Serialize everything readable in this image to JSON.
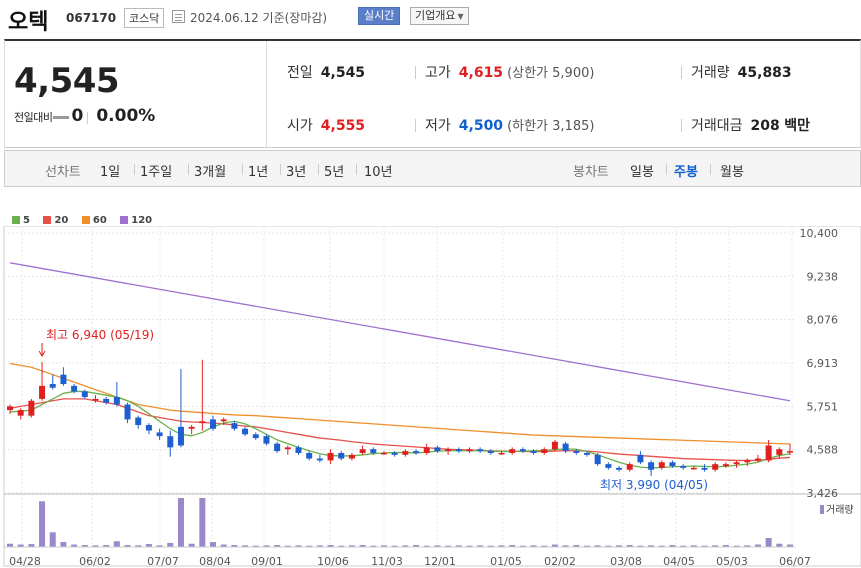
{
  "header": {
    "name": "오텍",
    "code": "067170",
    "market": "코스닥",
    "date": "2024.06.12",
    "basis": "기준(장마감)",
    "realtime_button": "실시간",
    "company_button": "기업개요"
  },
  "summary": {
    "current_price": "4,545",
    "change_label": "전일대비",
    "change_value": "0",
    "change_pct": "0.00%",
    "prev_close_label": "전일",
    "prev_close": "4,545",
    "high_label": "고가",
    "high": "4,615",
    "upper_limit": "(상한가 5,900)",
    "volume_label": "거래량",
    "volume": "45,883",
    "open_label": "시가",
    "open": "4,555",
    "low_label": "저가",
    "low": "4,500",
    "lower_limit": "(하한가 3,185)",
    "amount_label": "거래대금",
    "amount": "208",
    "amount_unit": "백만"
  },
  "period_bar": {
    "line_label": "선차트",
    "line_options": [
      "1일",
      "1주일",
      "3개월",
      "1년",
      "3년",
      "5년",
      "10년"
    ],
    "candle_label": "봉차트",
    "candle_options": [
      "일봉",
      "주봉",
      "월봉"
    ],
    "selected": "주봉"
  },
  "legend": [
    {
      "label": "5",
      "color": "#6ab04c"
    },
    {
      "label": "20",
      "color": "#e8504a"
    },
    {
      "label": "60",
      "color": "#f0902c"
    },
    {
      "label": "120",
      "color": "#a070d0"
    }
  ],
  "chart_data": {
    "type": "candlestick",
    "interval": "weekly",
    "y_ticks": [
      "10,400",
      "9,238",
      "8,076",
      "6,913",
      "5,751",
      "4,588",
      "3,426"
    ],
    "ylim": [
      3426,
      10400
    ],
    "x_ticks": [
      "04/28",
      "06/02",
      "07/07",
      "08/04",
      "09/01",
      "10/06",
      "11/03",
      "12/01",
      "01/05",
      "02/02",
      "03/08",
      "04/05",
      "05/03",
      "06/07"
    ],
    "volume_label": "거래량",
    "annotations": [
      {
        "text": "최고 6,940 (05/19)",
        "value": 6940
      },
      {
        "text": "최저 3,990 (04/05)",
        "value": 3990
      }
    ],
    "candles": [
      {
        "o": 5650,
        "h": 5800,
        "l": 5550,
        "c": 5750
      },
      {
        "o": 5500,
        "h": 5700,
        "l": 5400,
        "c": 5650
      },
      {
        "o": 5500,
        "h": 5950,
        "l": 5450,
        "c": 5900
      },
      {
        "o": 5950,
        "h": 6940,
        "l": 5900,
        "c": 6300
      },
      {
        "o": 6350,
        "h": 6600,
        "l": 6200,
        "c": 6250
      },
      {
        "o": 6600,
        "h": 6800,
        "l": 6300,
        "c": 6350
      },
      {
        "o": 6300,
        "h": 6350,
        "l": 6100,
        "c": 6150
      },
      {
        "o": 6150,
        "h": 6200,
        "l": 5950,
        "c": 6000
      },
      {
        "o": 5950,
        "h": 6050,
        "l": 5850,
        "c": 5950
      },
      {
        "o": 5950,
        "h": 6000,
        "l": 5800,
        "c": 5850
      },
      {
        "o": 6000,
        "h": 6400,
        "l": 5750,
        "c": 5800
      },
      {
        "o": 5800,
        "h": 5850,
        "l": 5300,
        "c": 5400
      },
      {
        "o": 5450,
        "h": 5500,
        "l": 5150,
        "c": 5250
      },
      {
        "o": 5250,
        "h": 5300,
        "l": 5000,
        "c": 5100
      },
      {
        "o": 5050,
        "h": 5150,
        "l": 4850,
        "c": 4950
      },
      {
        "o": 4950,
        "h": 5100,
        "l": 4400,
        "c": 4650
      },
      {
        "o": 5200,
        "h": 6750,
        "l": 4650,
        "c": 4700
      },
      {
        "o": 5150,
        "h": 5250,
        "l": 5000,
        "c": 5200
      },
      {
        "o": 5300,
        "h": 7000,
        "l": 5100,
        "c": 5350
      },
      {
        "o": 5400,
        "h": 5500,
        "l": 5100,
        "c": 5150
      },
      {
        "o": 5350,
        "h": 5450,
        "l": 5250,
        "c": 5400
      },
      {
        "o": 5300,
        "h": 5350,
        "l": 5100,
        "c": 5150
      },
      {
        "o": 5150,
        "h": 5200,
        "l": 4950,
        "c": 5000
      },
      {
        "o": 5000,
        "h": 5050,
        "l": 4850,
        "c": 4900
      },
      {
        "o": 4950,
        "h": 5000,
        "l": 4700,
        "c": 4750
      },
      {
        "o": 4750,
        "h": 4800,
        "l": 4500,
        "c": 4550
      },
      {
        "o": 4600,
        "h": 4700,
        "l": 4450,
        "c": 4650
      },
      {
        "o": 4650,
        "h": 4700,
        "l": 4450,
        "c": 4500
      },
      {
        "o": 4500,
        "h": 4550,
        "l": 4300,
        "c": 4350
      },
      {
        "o": 4350,
        "h": 4450,
        "l": 4250,
        "c": 4300
      },
      {
        "o": 4300,
        "h": 4600,
        "l": 4200,
        "c": 4500
      },
      {
        "o": 4500,
        "h": 4550,
        "l": 4300,
        "c": 4350
      },
      {
        "o": 4350,
        "h": 4500,
        "l": 4300,
        "c": 4450
      },
      {
        "o": 4500,
        "h": 4700,
        "l": 4450,
        "c": 4600
      },
      {
        "o": 4600,
        "h": 4650,
        "l": 4450,
        "c": 4500
      },
      {
        "o": 4500,
        "h": 4550,
        "l": 4450,
        "c": 4500
      },
      {
        "o": 4500,
        "h": 4550,
        "l": 4400,
        "c": 4450
      },
      {
        "o": 4450,
        "h": 4600,
        "l": 4400,
        "c": 4550
      },
      {
        "o": 4550,
        "h": 4600,
        "l": 4450,
        "c": 4500
      },
      {
        "o": 4500,
        "h": 4750,
        "l": 4450,
        "c": 4650
      },
      {
        "o": 4650,
        "h": 4700,
        "l": 4500,
        "c": 4550
      },
      {
        "o": 4550,
        "h": 4650,
        "l": 4450,
        "c": 4600
      },
      {
        "o": 4600,
        "h": 4650,
        "l": 4500,
        "c": 4550
      },
      {
        "o": 4550,
        "h": 4650,
        "l": 4500,
        "c": 4600
      },
      {
        "o": 4600,
        "h": 4650,
        "l": 4500,
        "c": 4550
      },
      {
        "o": 4550,
        "h": 4600,
        "l": 4450,
        "c": 4500
      },
      {
        "o": 4500,
        "h": 4550,
        "l": 4450,
        "c": 4500
      },
      {
        "o": 4500,
        "h": 4650,
        "l": 4450,
        "c": 4600
      },
      {
        "o": 4600,
        "h": 4650,
        "l": 4500,
        "c": 4550
      },
      {
        "o": 4550,
        "h": 4600,
        "l": 4450,
        "c": 4500
      },
      {
        "o": 4500,
        "h": 4650,
        "l": 4450,
        "c": 4600
      },
      {
        "o": 4600,
        "h": 4850,
        "l": 4550,
        "c": 4800
      },
      {
        "o": 4750,
        "h": 4800,
        "l": 4500,
        "c": 4550
      },
      {
        "o": 4550,
        "h": 4600,
        "l": 4450,
        "c": 4500
      },
      {
        "o": 4500,
        "h": 4550,
        "l": 4400,
        "c": 4450
      },
      {
        "o": 4450,
        "h": 4500,
        "l": 4150,
        "c": 4200
      },
      {
        "o": 4200,
        "h": 4250,
        "l": 4050,
        "c": 4100
      },
      {
        "o": 4100,
        "h": 4150,
        "l": 4000,
        "c": 4050
      },
      {
        "o": 4050,
        "h": 4250,
        "l": 4000,
        "c": 4200
      },
      {
        "o": 4450,
        "h": 4550,
        "l": 4200,
        "c": 4250
      },
      {
        "o": 4250,
        "h": 4300,
        "l": 3990,
        "c": 4050
      },
      {
        "o": 4100,
        "h": 4300,
        "l": 4050,
        "c": 4250
      },
      {
        "o": 4250,
        "h": 4300,
        "l": 4100,
        "c": 4150
      },
      {
        "o": 4150,
        "h": 4200,
        "l": 4050,
        "c": 4100
      },
      {
        "o": 4100,
        "h": 4150,
        "l": 4050,
        "c": 4100
      },
      {
        "o": 4100,
        "h": 4200,
        "l": 4000,
        "c": 4050
      },
      {
        "o": 4050,
        "h": 4250,
        "l": 4000,
        "c": 4200
      },
      {
        "o": 4150,
        "h": 4250,
        "l": 4100,
        "c": 4200
      },
      {
        "o": 4200,
        "h": 4300,
        "l": 4100,
        "c": 4250
      },
      {
        "o": 4250,
        "h": 4350,
        "l": 4150,
        "c": 4300
      },
      {
        "o": 4300,
        "h": 4450,
        "l": 4250,
        "c": 4350
      },
      {
        "o": 4300,
        "h": 4850,
        "l": 4250,
        "c": 4700
      },
      {
        "o": 4450,
        "h": 4650,
        "l": 4350,
        "c": 4600
      },
      {
        "o": 4550,
        "h": 4750,
        "l": 4450,
        "c": 4550
      }
    ],
    "volumes": [
      20,
      15,
      18,
      280,
      90,
      30,
      15,
      12,
      10,
      12,
      35,
      12,
      10,
      18,
      10,
      25,
      300,
      20,
      300,
      30,
      15,
      12,
      10,
      8,
      10,
      12,
      8,
      10,
      8,
      10,
      12,
      8,
      10,
      12,
      8,
      10,
      8,
      10,
      12,
      8,
      10,
      8,
      10,
      8,
      10,
      8,
      10,
      12,
      8,
      10,
      8,
      15,
      10,
      12,
      8,
      10,
      8,
      10,
      12,
      8,
      10,
      8,
      12,
      8,
      10,
      8,
      10,
      12,
      8,
      10,
      15,
      55,
      20,
      15
    ],
    "ma": {
      "120": [
        9600,
        5900
      ],
      "60": [
        6900,
        6850,
        6800,
        6700,
        6600,
        6500,
        6400,
        6300,
        6200,
        6100,
        6000,
        5900,
        5800,
        5750,
        5700,
        5650,
        5620,
        5600,
        5580,
        5560,
        5540,
        5520,
        5510,
        5500,
        5480,
        5460,
        5440,
        5420,
        5400,
        5380,
        5360,
        5340,
        5320,
        5300,
        5280,
        5260,
        5240,
        5220,
        5200,
        5180,
        5160,
        5140,
        5120,
        5100,
        5080,
        5060,
        5040,
        5020,
        5000,
        4980,
        4970,
        4960,
        4950,
        4940,
        4930,
        4920,
        4910,
        4900,
        4890,
        4880,
        4870,
        4860,
        4850,
        4840,
        4830,
        4820,
        4810,
        4800,
        4790,
        4780,
        4770,
        4760,
        4750,
        4740
      ],
      "20": [
        5700,
        5750,
        5800,
        5850,
        5900,
        5950,
        5950,
        5950,
        5900,
        5850,
        5800,
        5700,
        5600,
        5500,
        5450,
        5400,
        5350,
        5330,
        5320,
        5300,
        5280,
        5250,
        5220,
        5200,
        5150,
        5100,
        5050,
        5000,
        4950,
        4900,
        4870,
        4840,
        4800,
        4770,
        4740,
        4720,
        4700,
        4680,
        4660,
        4640,
        4620,
        4600,
        4590,
        4580,
        4570,
        4560,
        4550,
        4545,
        4540,
        4535,
        4540,
        4550,
        4560,
        4560,
        4550,
        4530,
        4500,
        4470,
        4450,
        4430,
        4410,
        4390,
        4370,
        4350,
        4340,
        4330,
        4320,
        4310,
        4300,
        4300,
        4300,
        4330,
        4360,
        4380
      ],
      "5": [
        5600,
        5620,
        5650,
        5800,
        5950,
        6100,
        6150,
        6150,
        6100,
        6050,
        6000,
        5900,
        5750,
        5550,
        5350,
        5150,
        5000,
        4960,
        5050,
        5200,
        5300,
        5350,
        5280,
        5150,
        5000,
        4850,
        4750,
        4650,
        4560,
        4480,
        4430,
        4420,
        4420,
        4450,
        4480,
        4500,
        4510,
        4510,
        4500,
        4520,
        4550,
        4560,
        4560,
        4560,
        4560,
        4550,
        4540,
        4540,
        4550,
        4560,
        4570,
        4590,
        4610,
        4600,
        4540,
        4450,
        4350,
        4250,
        4170,
        4120,
        4100,
        4110,
        4130,
        4140,
        4150,
        4140,
        4130,
        4140,
        4170,
        4200,
        4250,
        4350,
        4430,
        4480
      ]
    }
  }
}
